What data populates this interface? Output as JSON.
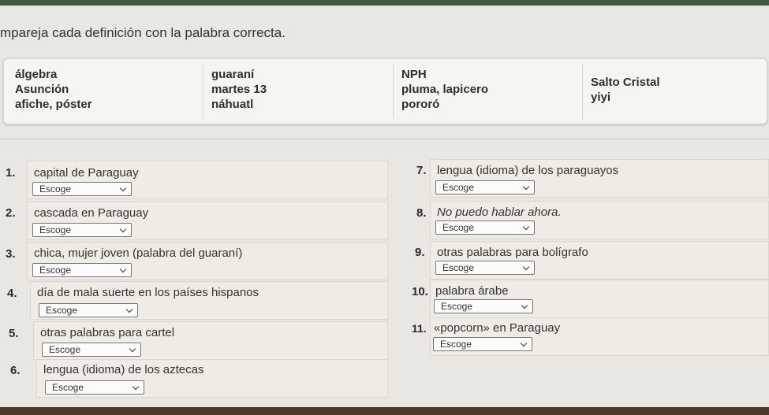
{
  "instructions": "mpareja cada definición con la palabra correcta.",
  "word_bank": [
    [
      "álgebra",
      "Asunción",
      "afiche, póster"
    ],
    [
      "guaraní",
      "martes 13",
      "náhuatl"
    ],
    [
      "NPH",
      "pluma, lapicero",
      "pororó"
    ],
    [
      "Salto Cristal",
      "yiyi"
    ]
  ],
  "select_placeholder": "Escoge",
  "questions": [
    {
      "num": "1.",
      "text": "capital de Paraguay",
      "select": "Escoge"
    },
    {
      "num": "2.",
      "text": "cascada en Paraguay",
      "select": "Escoge"
    },
    {
      "num": "3.",
      "text": "chica, mujer joven (palabra del guaraní)",
      "select": "Escoge"
    },
    {
      "num": "4.",
      "text": "día de mala suerte en los países hispanos",
      "select": "Escoge"
    },
    {
      "num": "5.",
      "text": "otras palabras para cartel",
      "select": "Escoge"
    },
    {
      "num": "6.",
      "text": "lengua (idioma) de los aztecas",
      "select": "Escoge"
    },
    {
      "num": "7.",
      "text": "lengua (idioma) de los paraguayos",
      "select": "Escoge"
    },
    {
      "num": "8.",
      "text": "No puedo hablar ahora.",
      "select": "Escoge"
    },
    {
      "num": "9.",
      "text": "otras palabras para bolígrafo",
      "select": "Escoge"
    },
    {
      "num": "10.",
      "text": "palabra árabe",
      "select": "Escoge"
    },
    {
      "num": "11.",
      "text": "«popcorn» en Paraguay",
      "select": "Escoge"
    }
  ]
}
